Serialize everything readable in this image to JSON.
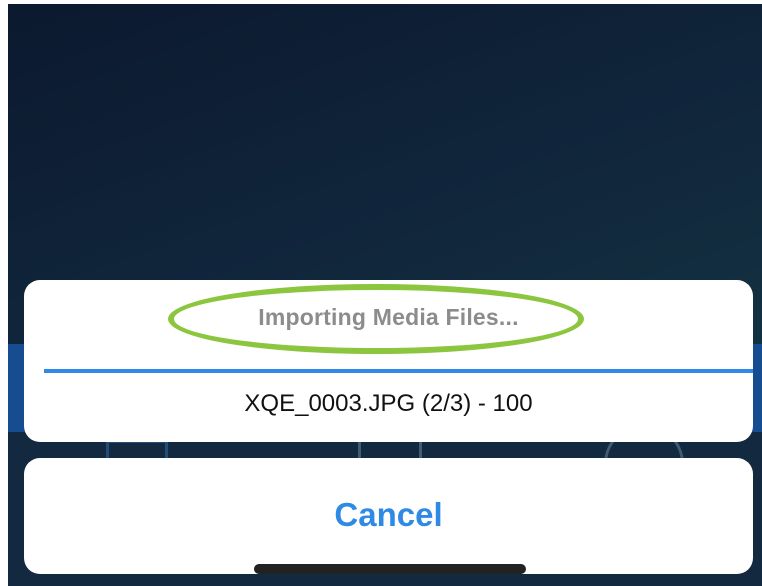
{
  "import_sheet": {
    "title": "Importing Media Files...",
    "file_status": "XQE_0003.JPG (2/3) - 100",
    "progress": 1.0,
    "cancel_label": "Cancel"
  },
  "colors": {
    "accent": "#2f8ae6",
    "highlight_ring": "#8cc63f",
    "background_top": "#0f1f3a",
    "background_bottom": "#1a4a55"
  },
  "icons": [
    "layout-icon",
    "trash-icon",
    "close-circle-icon"
  ]
}
